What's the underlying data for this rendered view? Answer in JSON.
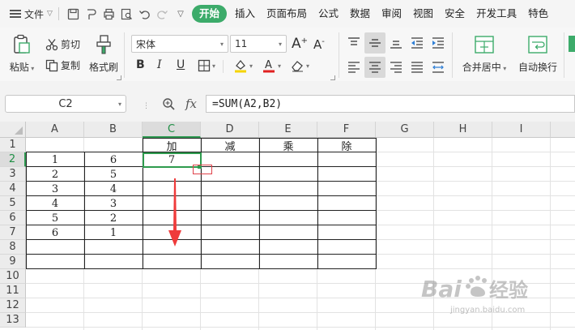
{
  "menubar": {
    "file_label": "文件",
    "tabs": [
      "开始",
      "插入",
      "页面布局",
      "公式",
      "数据",
      "审阅",
      "视图",
      "安全",
      "开发工具",
      "特色"
    ],
    "active_tab": "开始"
  },
  "ribbon": {
    "paste": "粘贴",
    "cut": "剪切",
    "copy": "复制",
    "format_painter": "格式刷",
    "font_name": "宋体",
    "font_size": "11",
    "merge_center": "合并居中",
    "wrap_text": "自动换行",
    "font_color": "#e02020",
    "fill_color": "#f5d400"
  },
  "formula_bar": {
    "name_box": "C2",
    "fx": "fx",
    "formula": "=SUM(A2,B2)"
  },
  "sheet": {
    "columns": [
      "A",
      "B",
      "C",
      "D",
      "E",
      "F",
      "G",
      "H",
      "I"
    ],
    "rows": [
      "1",
      "2",
      "3",
      "4",
      "5",
      "6",
      "7",
      "8",
      "9",
      "10",
      "11",
      "12",
      "13"
    ],
    "selected_cell": "C2",
    "headers": [
      "加",
      "减",
      "乘",
      "除"
    ],
    "col_a": [
      "1",
      "2",
      "3",
      "4",
      "5",
      "6"
    ],
    "col_b": [
      "6",
      "5",
      "4",
      "3",
      "2",
      "1"
    ],
    "c2_value": "7"
  },
  "watermark": {
    "brand": "Baidu经验",
    "url": "jingyan.baidu.com"
  },
  "colors": {
    "accent": "#3cab6a",
    "selection": "#2e9b4e",
    "arrow": "#ef3b3b"
  }
}
